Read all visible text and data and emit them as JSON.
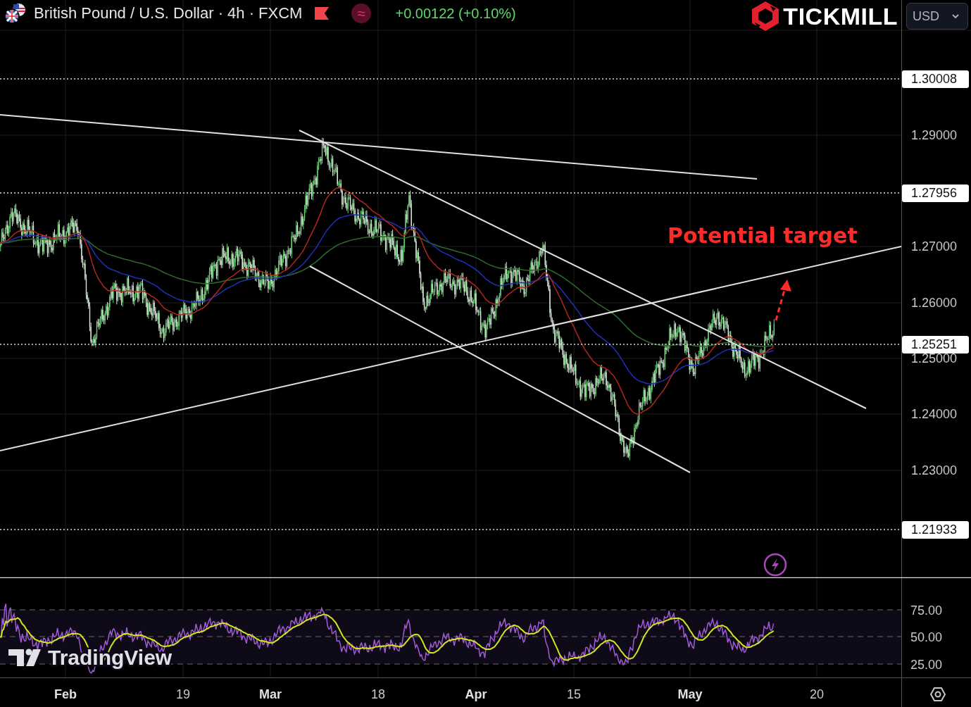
{
  "header": {
    "symbol_title": "British Pound / U.S. Dollar · 4h · FXCM",
    "indicator_glyph": "≈",
    "change": "+0.00122 (+0.10%)"
  },
  "brand": {
    "logo_text": "TICKMILL",
    "currency_select": {
      "value": "USD"
    }
  },
  "price_axis": {
    "ticks": [
      "1.29000",
      "1.27000",
      "1.26000",
      "1.25000",
      "1.24000",
      "1.23000"
    ],
    "level_labels": [
      "1.30008",
      "1.27956",
      "1.25251",
      "1.21933"
    ]
  },
  "annotation": {
    "text": "Potential target"
  },
  "rsi_axis": {
    "ticks": [
      "75.00",
      "50.00",
      "25.00"
    ]
  },
  "time_axis": {
    "labels": [
      {
        "text": "Feb",
        "kind": "month"
      },
      {
        "text": "19",
        "kind": "day"
      },
      {
        "text": "Mar",
        "kind": "month"
      },
      {
        "text": "18",
        "kind": "day"
      },
      {
        "text": "Apr",
        "kind": "month"
      },
      {
        "text": "15",
        "kind": "day"
      },
      {
        "text": "May",
        "kind": "month"
      },
      {
        "text": "20",
        "kind": "day"
      }
    ]
  },
  "watermark": {
    "text": "TradingView"
  }
}
